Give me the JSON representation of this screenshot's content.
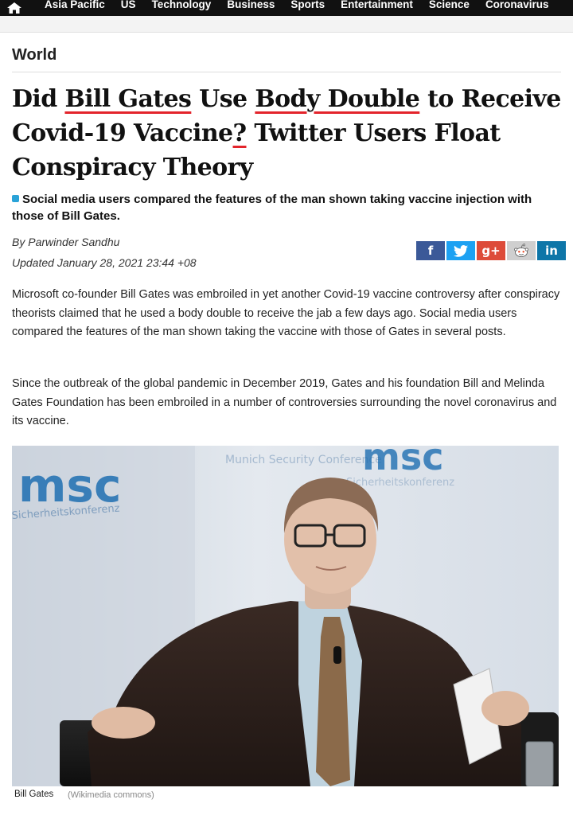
{
  "nav": {
    "home_icon": "home-icon",
    "items": [
      "Asia Pacific",
      "US",
      "Technology",
      "Business",
      "Sports",
      "Entertainment",
      "Science",
      "Coronavirus"
    ]
  },
  "article": {
    "section": "World",
    "headline_parts": [
      "Did ",
      "Bill Gates",
      " Use ",
      "Body Double",
      " to Receive Covid-19 Vaccine",
      "?",
      " Twitter Users Float Conspiracy Theory"
    ],
    "subheadline": "Social media users compared the features of the man shown taking vaccine injection with those of Bill Gates.",
    "byline_prefix": "By",
    "author": "Parwinder Sandhu",
    "updated": "Updated January 28, 2021 23:44 +08",
    "paragraphs": [
      "Microsoft co-founder Bill Gates was embroiled in yet another Covid-19 vaccine controversy after conspiracy theorists claimed that he used a body double to receive the jab a few days ago. Social media users compared the features of the man shown taking the vaccine with those of Gates in several posts.",
      "Since the outbreak of the global pandemic in December 2019, Gates and his foundation Bill and Melinda Gates Foundation has been embroiled in a number of controversies surrounding the novel coronavirus and its vaccine."
    ],
    "photo": {
      "backdrop_logo": "msc",
      "backdrop_small_text": "Munich Security Conference",
      "backdrop_small_text_2": "Sicherheitskonferenz",
      "caption": "Bill Gates",
      "credit": "(Wikimedia commons)"
    }
  },
  "share": {
    "facebook": "f",
    "twitter_icon": "twitter-bird-icon",
    "googleplus": "g+",
    "reddit_icon": "reddit-alien-icon",
    "linkedin": "in"
  },
  "colors": {
    "nav_bg": "#111111",
    "annotation_underline": "#e3242b",
    "bullet": "#2aa3d8",
    "msc_blue": "#1f6fb2"
  }
}
